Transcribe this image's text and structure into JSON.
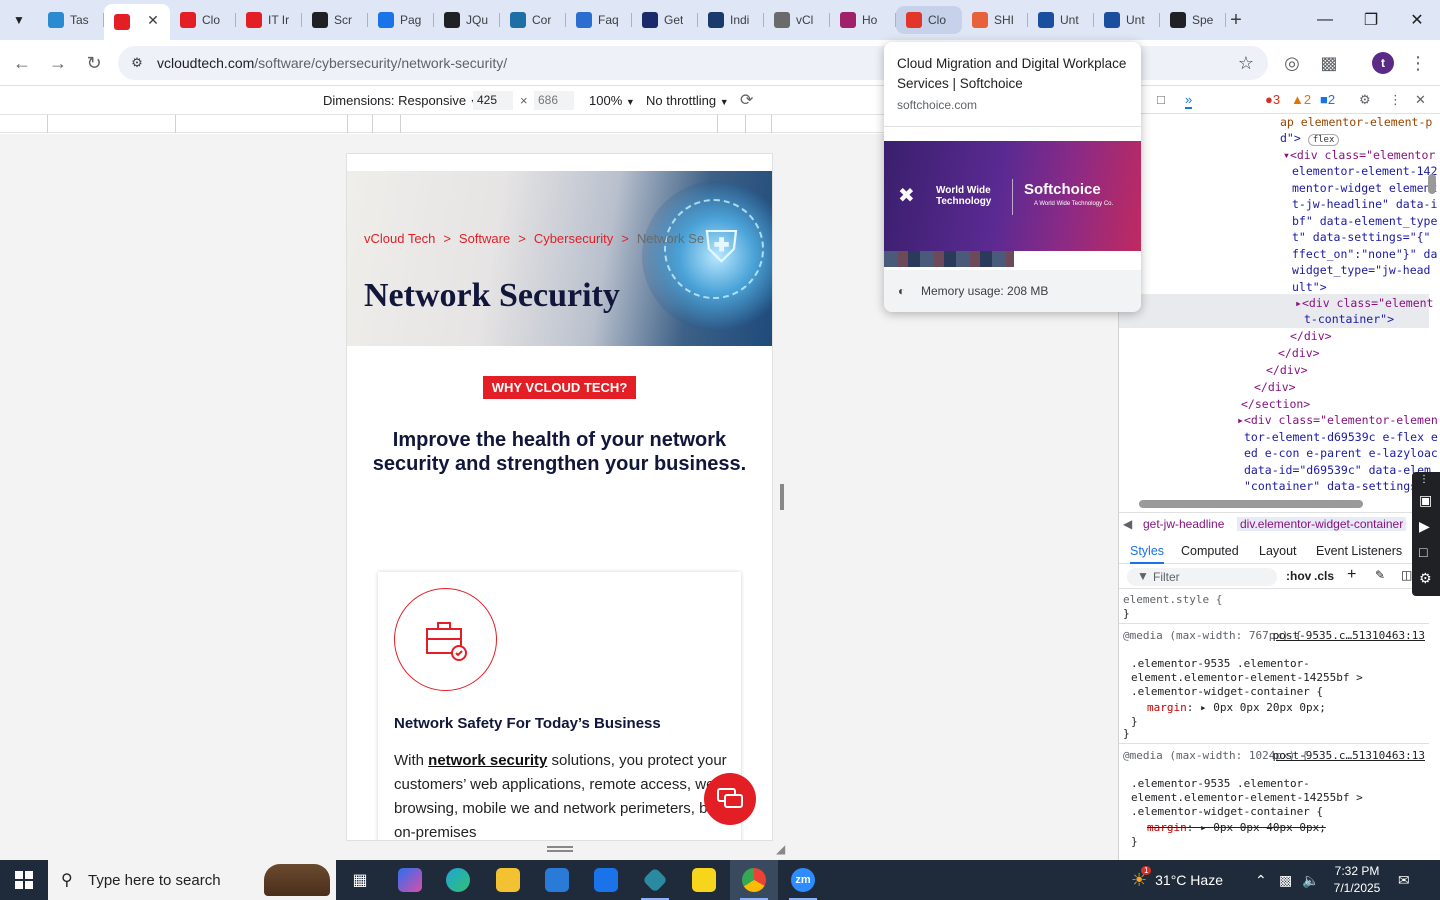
{
  "browser": {
    "tabs": [
      {
        "label": "Tas",
        "icon": "tasks-icon",
        "color": "#2a8bd0"
      },
      {
        "label": "",
        "icon": "vcloud-favicon",
        "color": "#e31e24",
        "active": true
      },
      {
        "label": "Clo",
        "icon": "vcloud-favicon",
        "color": "#e31e24"
      },
      {
        "label": "IT Ir",
        "icon": "vcloud-favicon",
        "color": "#e31e24"
      },
      {
        "label": "Scr",
        "icon": "screen-icon",
        "color": "#202124"
      },
      {
        "label": "Pag",
        "icon": "pagespeed-icon",
        "color": "#1a73e8"
      },
      {
        "label": "JQu",
        "icon": "jquery-icon",
        "color": "#202124"
      },
      {
        "label": "Cor",
        "icon": "cor-icon",
        "color": "#1d6fa5"
      },
      {
        "label": "Faq",
        "icon": "sitemap-icon",
        "color": "#2a6fd0"
      },
      {
        "label": "Get",
        "icon": "x-logo-icon",
        "color": "#1a2a6c"
      },
      {
        "label": "Indi",
        "icon": "indi-icon",
        "color": "#1a3a6c"
      },
      {
        "label": "vCl",
        "icon": "dot-icon",
        "color": "#6a6a6a"
      },
      {
        "label": "Ho",
        "icon": "ho-icon",
        "color": "#a0206a"
      },
      {
        "label": "Clo",
        "icon": "softchoice-icon",
        "color": "#e3362a",
        "hovered": true
      },
      {
        "label": "SHI",
        "icon": "shi-icon",
        "color": "#e8613a"
      },
      {
        "label": "Unt",
        "icon": "docs-icon",
        "color": "#1a4fa0"
      },
      {
        "label": "Unt",
        "icon": "docs-icon",
        "color": "#1a4fa0"
      },
      {
        "label": "Spe",
        "icon": "speed-icon",
        "color": "#202124"
      }
    ],
    "url_host": "vcloudtech.com",
    "url_path": "/software/cybersecurity/network-security/",
    "profile_initial": "t"
  },
  "device_toolbar": {
    "dimensions_label": "Dimensions: Responsive",
    "width": "425",
    "height": "686",
    "zoom": "100%",
    "throttling": "No throttling"
  },
  "page": {
    "breadcrumb": [
      "vCloud Tech",
      "Software",
      "Cybersecurity",
      "Network Se"
    ],
    "breadcrumb_sep": ">",
    "title": "Network Security",
    "badge": "WHY VCLOUD TECH?",
    "headline": "Improve the health of your network security and strengthen your business.",
    "card_title": "Network Safety For Today’s Business",
    "card_text_before": "With ",
    "card_link": "network security",
    "card_text_after": " solutions, you protect your customers’ web applications, remote access, web browsing, mobile we and network perimeters, both on-premises",
    "accent": "#e31e24",
    "navy": "#11163a"
  },
  "hovercard": {
    "title": "Cloud Migration and Digital Workplace Services | Softchoice",
    "domain": "softchoice.com",
    "logo_left": "World Wide Technology",
    "logo_right": "Softchoice",
    "logo_right_sub": "A World Wide Technology Co.",
    "memory": "Memory usage: 208 MB"
  },
  "devtools": {
    "errors": "3",
    "warnings": "2",
    "messages": "2",
    "dom_lines": [
      "ap elementor-element-p",
      "d\">",
      "<div class=\"elementor",
      "elementor-element-142",
      "mentor-widget element",
      "t-jw-headline\" data-i",
      "bf\" data-element_type",
      "t\" data-settings=\"{\"",
      "ffect_on\":\"none\"}\" da",
      "widget_type=\"jw-head",
      "ult\">",
      "<div class=\"element",
      "t-container\">",
      "</div>",
      "</div>",
      "</div>",
      "</div>",
      "</section>",
      "<div class=\"elementor-elemen",
      "tor-element-d69539c e-flex e",
      "ed e-con e-parent e-lazyloac",
      "data-id=\"d69539c\" data-elem",
      "\"container\" data-settings="
    ],
    "flex_badge": "flex",
    "crumbs": [
      "get-jw-headline",
      "div.elementor-widget-container"
    ],
    "style_tabs": [
      "Styles",
      "Computed",
      "Layout",
      "Event Listeners"
    ],
    "filter_placeholder": "Filter",
    "hov": ":hov",
    "cls": ".cls",
    "styles": {
      "element_style": "element.style {",
      "close": "}",
      "media1": "@media (max-width: 767px) {",
      "media1_link": "post-9535.c…51310463:13",
      "sel1a": ".elementor-9535 .elementor-",
      "sel1b": "element.elementor-element-14255bf >",
      "sel1c": ".elementor-widget-container {",
      "prop1": "margin",
      "val1": "0px 0px 20px 0px;",
      "media2": "@media (max-width: 1024px) {",
      "media2_link": "post-9535.c…51310463:13",
      "val2": "0px 0px 40px 0px;"
    }
  },
  "taskbar": {
    "search_placeholder": "Type here to search",
    "weather": "31°C  Haze",
    "time": "7:32 PM",
    "date": "7/1/2025",
    "notification_count": "1"
  }
}
